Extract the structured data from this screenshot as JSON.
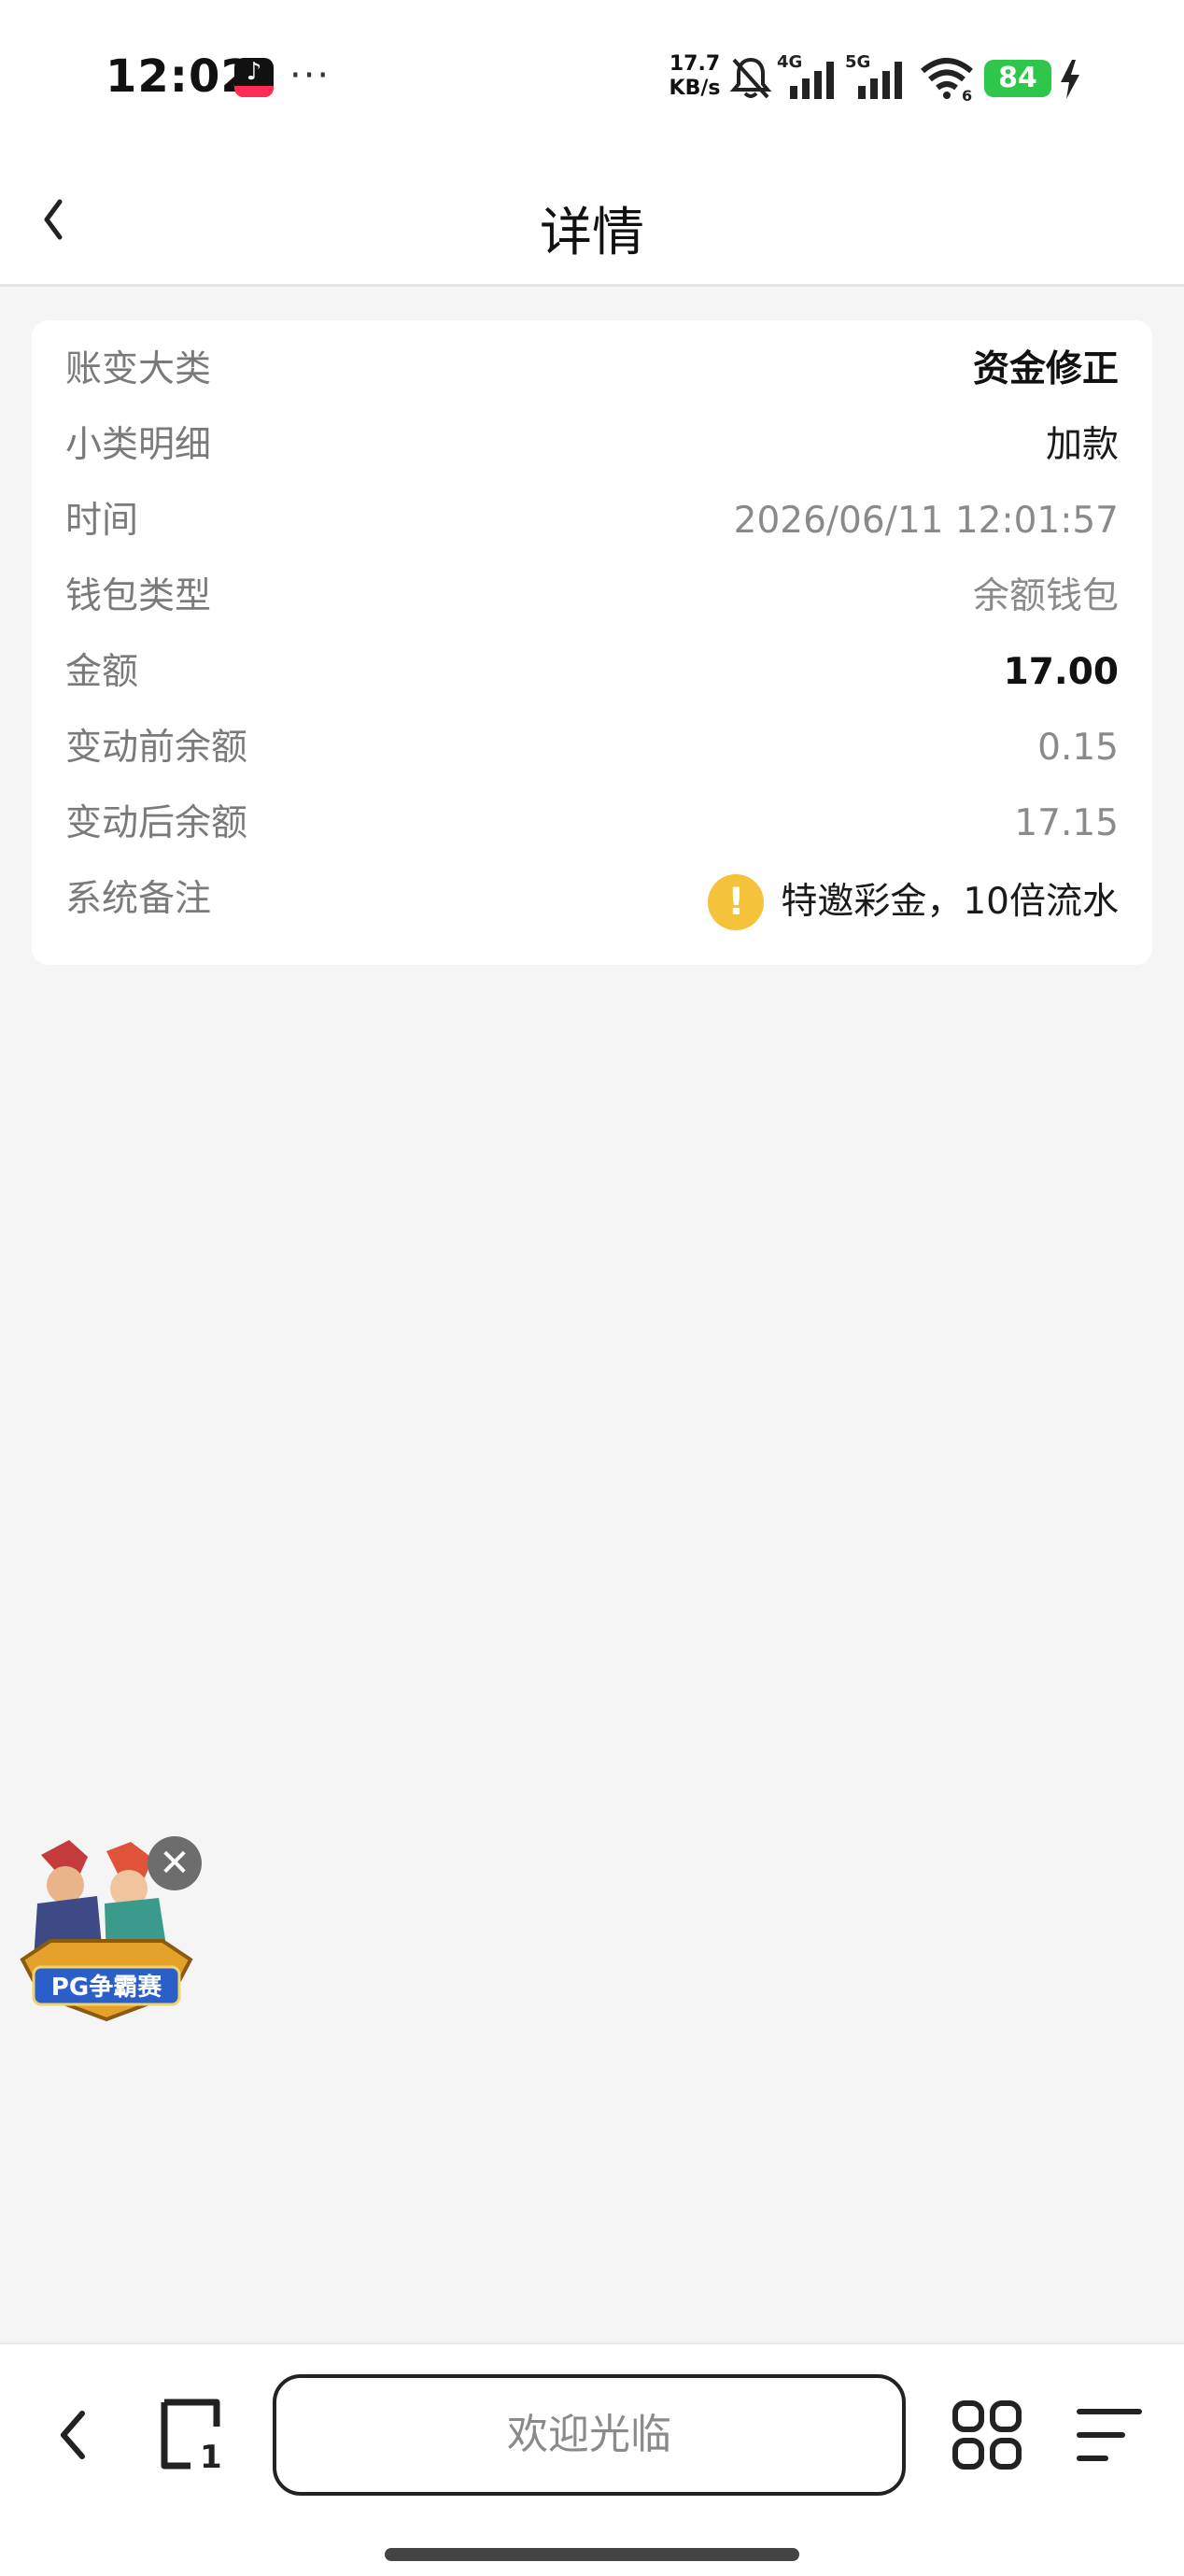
{
  "status_bar": {
    "time": "12:02",
    "more": "···",
    "net_speed_value": "17.7",
    "net_speed_unit": "KB/s",
    "mobile_4g": "4G",
    "mobile_5g": "5G",
    "wifi_sub": "6",
    "battery": "84"
  },
  "header": {
    "title": "详情"
  },
  "details": {
    "rows": [
      {
        "label": "账变大类",
        "value": "资金修正"
      },
      {
        "label": "小类明细",
        "value": "加款"
      },
      {
        "label": "时间",
        "value": "2026/06/11 12:01:57"
      },
      {
        "label": "钱包类型",
        "value": "余额钱包"
      },
      {
        "label": "金额",
        "value": "17.00"
      },
      {
        "label": "变动前余额",
        "value": "0.15"
      },
      {
        "label": "变动后余额",
        "value": "17.15"
      },
      {
        "label": "系统备注",
        "value": "特邀彩金，10倍流水"
      }
    ]
  },
  "promo": {
    "logo_text": "PG争霸赛",
    "close": "✕"
  },
  "toolbar": {
    "address_text": "欢迎光临",
    "tab_count": "1"
  },
  "colors": {
    "accent_green": "#2fc74b",
    "warning_yellow": "#f5c33b",
    "page_bg": "#f5f5f5"
  }
}
